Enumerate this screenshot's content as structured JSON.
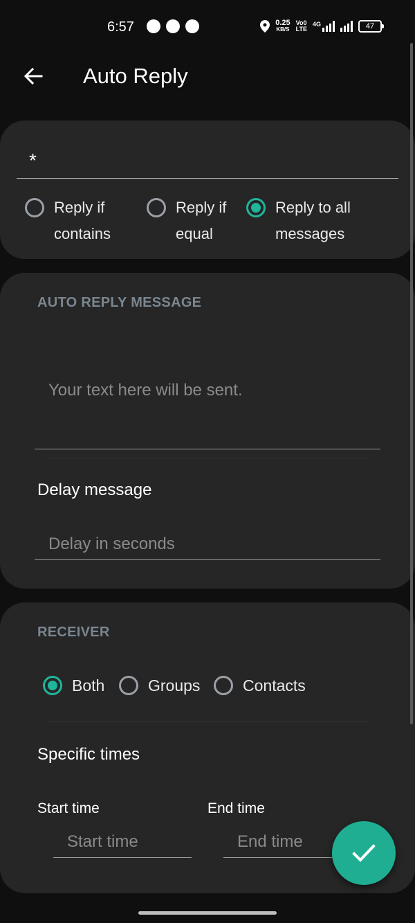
{
  "status_bar": {
    "time": "6:57",
    "net_speed_value": "0.25",
    "net_speed_unit": "KB/S",
    "volte_line1": "Vo0",
    "volte_line2": "LTE",
    "network_type": "4G",
    "battery": "47"
  },
  "app_bar": {
    "title": "Auto Reply"
  },
  "match_card": {
    "keyword_value": "*",
    "options": [
      {
        "label_line1": "Reply if",
        "label_line2": "contains",
        "selected": false
      },
      {
        "label_line1": "Reply if",
        "label_line2": "equal",
        "selected": false
      },
      {
        "label_line1": "Reply to all",
        "label_line2": "messages",
        "selected": true
      }
    ]
  },
  "message_card": {
    "section_label": "AUTO REPLY MESSAGE",
    "message_placeholder": "Your text here will be sent.",
    "delay_title": "Delay message",
    "delay_placeholder": "Delay in seconds"
  },
  "receiver_card": {
    "section_label": "RECEIVER",
    "options": [
      {
        "label": "Both",
        "selected": true
      },
      {
        "label": "Groups",
        "selected": false
      },
      {
        "label": "Contacts",
        "selected": false
      }
    ],
    "specific_times_title": "Specific times",
    "start_time_label": "Start time",
    "start_time_placeholder": "Start time",
    "end_time_label": "End time",
    "end_time_placeholder": "End time"
  },
  "colors": {
    "accent": "#1fb59a",
    "card": "#262626",
    "background": "#0f0f0f",
    "section_label": "#7a8690"
  },
  "icons": {
    "back": "arrow-left-icon",
    "fab": "check-icon"
  }
}
